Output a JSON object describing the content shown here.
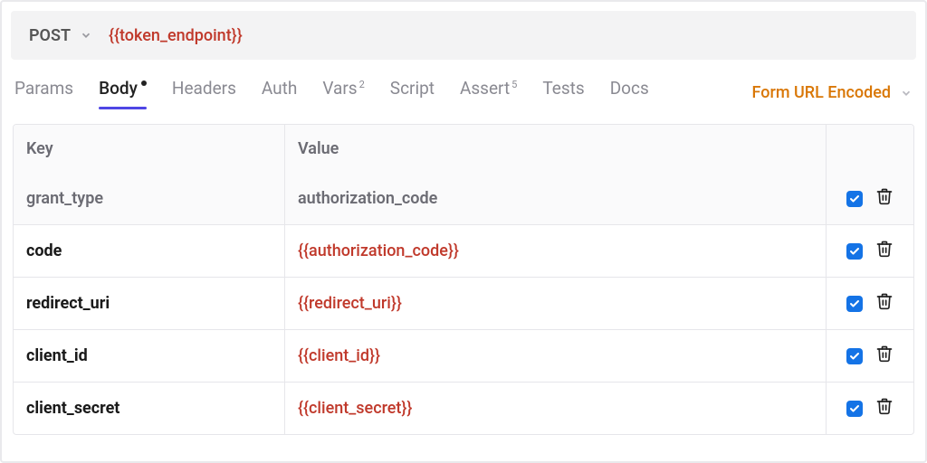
{
  "request": {
    "method": "POST",
    "url": "{{token_endpoint}}"
  },
  "tabs": {
    "params": {
      "label": "Params"
    },
    "body": {
      "label": "Body",
      "dirty": true
    },
    "headers": {
      "label": "Headers"
    },
    "auth": {
      "label": "Auth"
    },
    "vars": {
      "label": "Vars",
      "badge": "2"
    },
    "script": {
      "label": "Script"
    },
    "assert": {
      "label": "Assert",
      "badge": "5"
    },
    "tests": {
      "label": "Tests"
    },
    "docs": {
      "label": "Docs"
    }
  },
  "body_type": {
    "label": "Form URL Encoded"
  },
  "table": {
    "headers": {
      "key": "Key",
      "value": "Value"
    },
    "rows": [
      {
        "key": "grant_type",
        "value": "authorization_code",
        "is_var": false,
        "enabled": true
      },
      {
        "key": "code",
        "value": "{{authorization_code}}",
        "is_var": true,
        "enabled": true
      },
      {
        "key": "redirect_uri",
        "value": "{{redirect_uri}}",
        "is_var": true,
        "enabled": true
      },
      {
        "key": "client_id",
        "value": "{{client_id}}",
        "is_var": true,
        "enabled": true
      },
      {
        "key": "client_secret",
        "value": "{{client_secret}}",
        "is_var": true,
        "enabled": true
      }
    ]
  }
}
